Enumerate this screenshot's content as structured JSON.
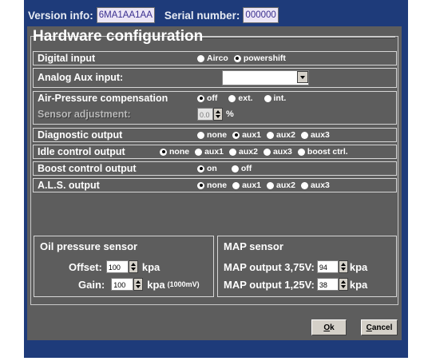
{
  "header": {
    "version_label": "Version info:",
    "version_value": "6MA1AA1AA",
    "serial_label": "Serial number:",
    "serial_value": "000000"
  },
  "panel": {
    "title": "Hardware configuration",
    "rows": [
      {
        "label": "Digital input",
        "options": [
          {
            "label": "Airco",
            "selected": false
          },
          {
            "label": "powershift",
            "selected": true
          }
        ]
      },
      {
        "label": "Analog Aux input:",
        "dropdown_value": ""
      },
      {
        "label": "Air-Pressure compensation",
        "options": [
          {
            "label": "off",
            "selected": true
          },
          {
            "label": "ext.",
            "selected": false
          },
          {
            "label": "int.",
            "selected": false
          }
        ]
      },
      {
        "label": "Sensor adjustment:",
        "value": "0.0",
        "unit": "%"
      },
      {
        "label": "Diagnostic output",
        "options": [
          {
            "label": "none",
            "selected": false
          },
          {
            "label": "aux1",
            "selected": true
          },
          {
            "label": "aux2",
            "selected": false
          },
          {
            "label": "aux3",
            "selected": false
          }
        ]
      },
      {
        "label": "Idle control output",
        "options": [
          {
            "label": "none",
            "selected": true
          },
          {
            "label": "aux1",
            "selected": false
          },
          {
            "label": "aux2",
            "selected": false
          },
          {
            "label": "aux3",
            "selected": false
          },
          {
            "label": "boost ctrl.",
            "selected": false
          }
        ]
      },
      {
        "label": "Boost control output",
        "options": [
          {
            "label": "on",
            "selected": true
          },
          {
            "label": "off",
            "selected": false
          }
        ]
      },
      {
        "label": "A.L.S. output",
        "options": [
          {
            "label": "none",
            "selected": true
          },
          {
            "label": "aux1",
            "selected": false
          },
          {
            "label": "aux2",
            "selected": false
          },
          {
            "label": "aux3",
            "selected": false
          }
        ]
      }
    ]
  },
  "oil_sensor": {
    "title": "Oil pressure sensor",
    "offset_label": "Offset:",
    "offset_value": "100",
    "offset_unit": "kpa",
    "gain_label": "Gain:",
    "gain_value": "100",
    "gain_unit": "kpa",
    "gain_note": "(1000mV)"
  },
  "map_sensor": {
    "title": "MAP sensor",
    "out1_label": "MAP output 3,75V:",
    "out1_value": "94",
    "out1_unit": "kpa",
    "out2_label": "MAP output 1,25V:",
    "out2_value": "38",
    "out2_unit": "kpa"
  },
  "buttons": {
    "ok_mnemonic": "O",
    "ok_rest": "k",
    "cancel_mnemonic": "C",
    "cancel_rest": "ancel"
  },
  "colors": {
    "window_bg": "#1e3b7a",
    "panel_bg": "#5d5d5d",
    "text": "#ffffff"
  }
}
